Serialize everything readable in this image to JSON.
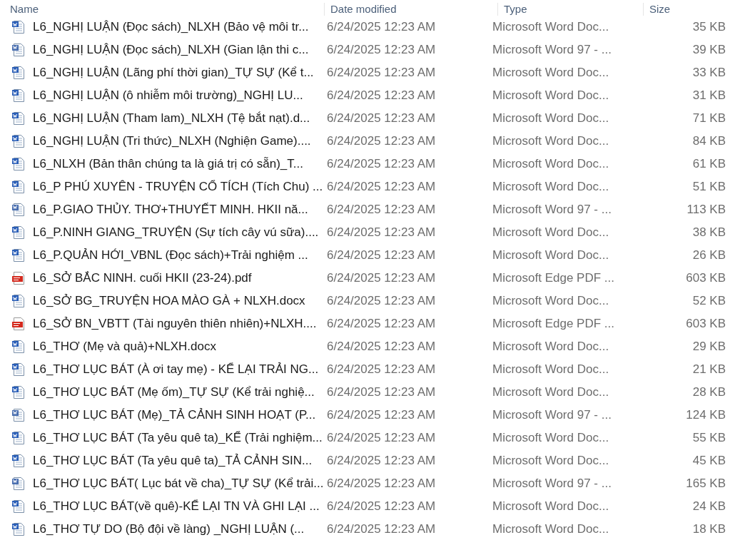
{
  "table": {
    "columns": [
      "Name",
      "Date modified",
      "Type",
      "Size"
    ],
    "rows": [
      {
        "kind": "word",
        "name": "L6_NGHỊ LUẬN (Đọc sách)_NLXH (Bảo vệ môi tr...",
        "date": "6/24/2025 12:23 AM",
        "type": "Microsoft Word Doc...",
        "size": "35 KB"
      },
      {
        "kind": "word97",
        "name": "L6_NGHỊ LUẬN (Đọc sách)_NLXH (Gian lận thi c...",
        "date": "6/24/2025 12:23 AM",
        "type": "Microsoft Word 97 - ...",
        "size": "39 KB"
      },
      {
        "kind": "word",
        "name": "L6_NGHỊ LUẬN (Lãng phí thời gian)_TỰ SỰ (Kể t...",
        "date": "6/24/2025 12:23 AM",
        "type": "Microsoft Word Doc...",
        "size": "33 KB"
      },
      {
        "kind": "word",
        "name": "L6_NGHỊ LUẬN (ô nhiễm môi trường)_NGHỊ LU...",
        "date": "6/24/2025 12:23 AM",
        "type": "Microsoft Word Doc...",
        "size": "31 KB"
      },
      {
        "kind": "word",
        "name": "L6_NGHỊ LUẬN (Tham lam)_NLXH (Tệ bắt nạt).d...",
        "date": "6/24/2025 12:23 AM",
        "type": "Microsoft Word Doc...",
        "size": "71 KB"
      },
      {
        "kind": "word",
        "name": "L6_NGHỊ LUẬN (Tri thức)_NLXH (Nghiện Game)....",
        "date": "6/24/2025 12:23 AM",
        "type": "Microsoft Word Doc...",
        "size": "84 KB"
      },
      {
        "kind": "word",
        "name": "L6_NLXH (Bản thân chúng ta là giá trị có sẵn)_T...",
        "date": "6/24/2025 12:23 AM",
        "type": "Microsoft Word Doc...",
        "size": "61 KB"
      },
      {
        "kind": "word",
        "name": "L6_P PHÚ XUYÊN - TRUYỆN CỔ TÍCH (Tích Chu) ...",
        "date": "6/24/2025 12:23 AM",
        "type": "Microsoft Word Doc...",
        "size": "51 KB"
      },
      {
        "kind": "word97",
        "name": "L6_P.GIAO THỦY. THƠ+THUYẾT MINH. HKII nă...",
        "date": "6/24/2025 12:23 AM",
        "type": "Microsoft Word 97 - ...",
        "size": "113 KB"
      },
      {
        "kind": "word",
        "name": "L6_P.NINH GIANG_TRUYỆN (Sự tích cây vú sữa)....",
        "date": "6/24/2025 12:23 AM",
        "type": "Microsoft Word Doc...",
        "size": "38 KB"
      },
      {
        "kind": "word",
        "name": "L6_P.QUẢN HỚI_VBNL (Đọc sách)+Trải nghiệm ...",
        "date": "6/24/2025 12:23 AM",
        "type": "Microsoft Word Doc...",
        "size": "26 KB"
      },
      {
        "kind": "pdf",
        "name": "L6_SỞ BẮC NINH. cuối HKII (23-24).pdf",
        "date": "6/24/2025 12:23 AM",
        "type": "Microsoft Edge PDF ...",
        "size": "603 KB"
      },
      {
        "kind": "word",
        "name": "L6_SỞ BG_TRUYỆN HOA MÀO GÀ + NLXH.docx",
        "date": "6/24/2025 12:23 AM",
        "type": "Microsoft Word Doc...",
        "size": "52 KB"
      },
      {
        "kind": "pdf",
        "name": "L6_SỞ BN_VBTT (Tài nguyên thiên nhiên)+NLXH....",
        "date": "6/24/2025 12:23 AM",
        "type": "Microsoft Edge PDF ...",
        "size": "603 KB"
      },
      {
        "kind": "word",
        "name": "L6_THƠ (Mẹ và quả)+NLXH.docx",
        "date": "6/24/2025 12:23 AM",
        "type": "Microsoft Word Doc...",
        "size": "29 KB"
      },
      {
        "kind": "word",
        "name": "L6_THƠ LỤC BÁT (À ơi tay mẹ) - KỂ LẠI TRẢI NG...",
        "date": "6/24/2025 12:23 AM",
        "type": "Microsoft Word Doc...",
        "size": "21 KB"
      },
      {
        "kind": "word",
        "name": "L6_THƠ LỤC BÁT (Mẹ ốm)_TỰ SỰ (Kể trải nghiệ...",
        "date": "6/24/2025 12:23 AM",
        "type": "Microsoft Word Doc...",
        "size": "28 KB"
      },
      {
        "kind": "word97",
        "name": "L6_THƠ LỤC BÁT (Mẹ)_TẢ CẢNH SINH HOẠT (P...",
        "date": "6/24/2025 12:23 AM",
        "type": "Microsoft Word 97 - ...",
        "size": "124 KB"
      },
      {
        "kind": "word",
        "name": "L6_THƠ LỤC BÁT (Ta yêu quê ta)_KỂ (Trải nghiệm...",
        "date": "6/24/2025 12:23 AM",
        "type": "Microsoft Word Doc...",
        "size": "55 KB"
      },
      {
        "kind": "word",
        "name": "L6_THƠ LỤC BÁT (Ta yêu quê ta)_TẢ  CẢNH SIN...",
        "date": "6/24/2025 12:23 AM",
        "type": "Microsoft Word Doc...",
        "size": "45 KB"
      },
      {
        "kind": "word97",
        "name": "L6_THƠ LỤC BÁT( Lục bát về cha)_TỰ SỰ (Kể trải...",
        "date": "6/24/2025 12:23 AM",
        "type": "Microsoft Word 97 - ...",
        "size": "165 KB"
      },
      {
        "kind": "word",
        "name": "L6_THƠ LỤC BÁT(về quê)-KỂ LẠI TN VÀ GHI LẠI ...",
        "date": "6/24/2025 12:23 AM",
        "type": "Microsoft Word Doc...",
        "size": "24 KB"
      },
      {
        "kind": "word",
        "name": "L6_THƠ TỰ DO (Bộ đội về làng) _NGHỊ LUẬN (...",
        "date": "6/24/2025 12:23 AM",
        "type": "Microsoft Word Doc...",
        "size": "18 KB"
      }
    ]
  }
}
